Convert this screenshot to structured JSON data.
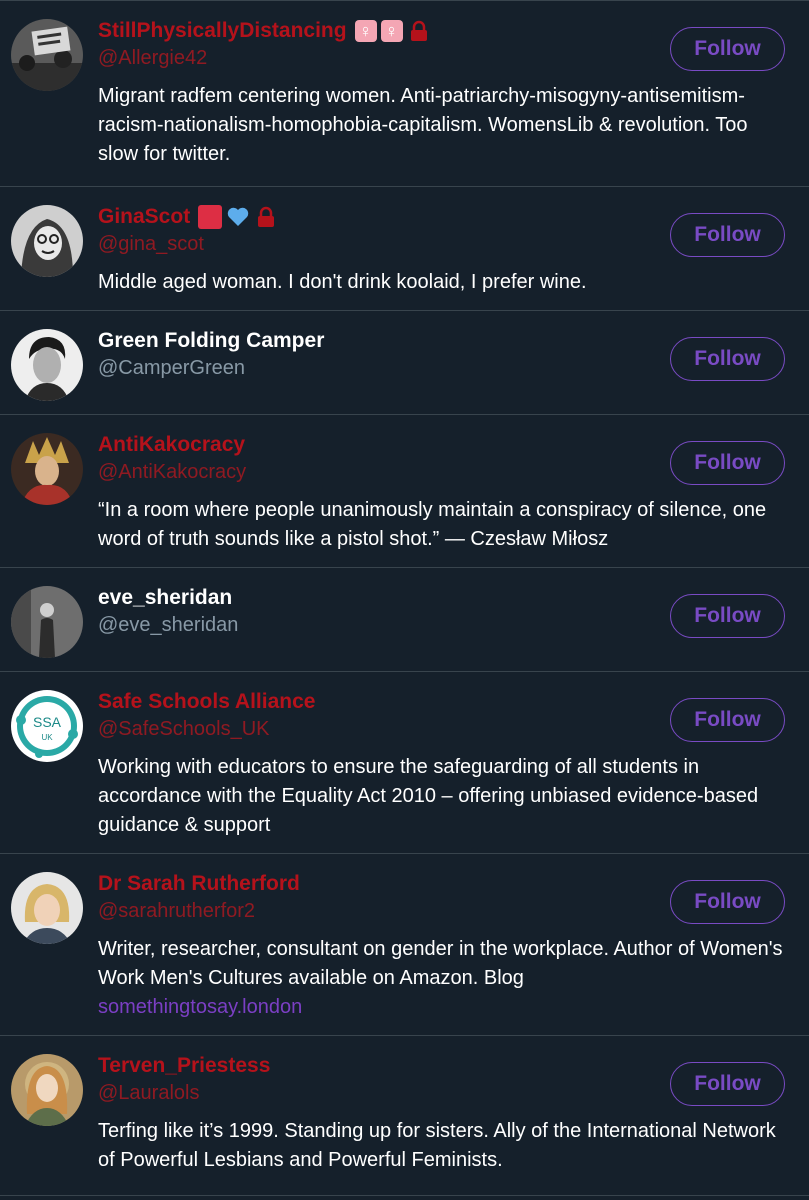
{
  "users": [
    {
      "name": "StillPhysicallyDistancing",
      "handle": "@Allergie42",
      "bio": "Migrant radfem centering women. Anti-patriarchy-misogyny-antisemitism-racism-nationalism-homophobia-capitalism. WomensLib & revolution. Too slow for twitter.",
      "follow_label": "Follow",
      "emoji": [
        "female-sign-icon",
        "female-sign-icon",
        "lock-icon"
      ],
      "name_color": "#b5121b"
    },
    {
      "name": "GinaScot",
      "handle": "@gina_scot",
      "bio": "Middle aged woman. I don't drink koolaid, I prefer wine.",
      "follow_label": "Follow",
      "emoji": [
        "red-square-icon",
        "blue-heart-icon",
        "lock-icon"
      ],
      "name_color": "#b5121b"
    },
    {
      "name": "Green Folding Camper",
      "handle": "@CamperGreen",
      "bio": "",
      "follow_label": "Follow",
      "name_color": "#ffffff"
    },
    {
      "name": "AntiKakocracy",
      "handle": "@AntiKakocracy",
      "bio": "“In a room where people unanimously maintain a conspiracy of silence, one word of truth sounds like a pistol shot.” — Czesław Miłosz",
      "follow_label": "Follow",
      "name_color": "#b5121b"
    },
    {
      "name": "eve_sheridan",
      "handle": "@eve_sheridan",
      "bio": "",
      "follow_label": "Follow",
      "name_color": "#ffffff"
    },
    {
      "name": "Safe Schools Alliance",
      "handle": "@SafeSchools_UK",
      "bio": "Working with educators to ensure the safeguarding of all students in accordance with the Equality Act 2010 – offering unbiased evidence-based guidance & support",
      "follow_label": "Follow",
      "avatar_text": "SSA",
      "avatar_subtext": "UK",
      "name_color": "#b5121b"
    },
    {
      "name": "Dr Sarah Rutherford",
      "handle": "@sarahrutherfor2",
      "bio": "Writer, researcher, consultant on gender in the workplace. Author of Women's Work Men's Cultures available on Amazon. Blog",
      "bio_link": "somethingtosay.london",
      "follow_label": "Follow",
      "name_color": "#b5121b"
    },
    {
      "name": "Terven_Priestess",
      "handle": "@Lauralols",
      "bio": "Terfing like it’s 1999. Standing up for sisters. Ally of the International Network of Powerful Lesbians and Powerful Feminists.",
      "follow_label": "Follow",
      "name_color": "#b5121b"
    }
  ],
  "colors": {
    "background": "#15202b",
    "divider": "#38444d",
    "follow_accent": "#794bc4",
    "link": "#7b3fc4",
    "muted": "#8899a6"
  }
}
